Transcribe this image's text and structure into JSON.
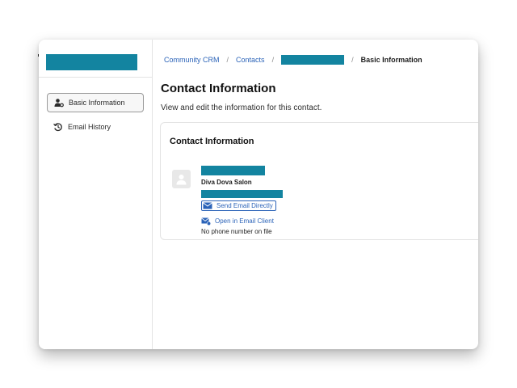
{
  "sidebar": {
    "items": [
      {
        "label": "Basic Information",
        "icon": "user-gear-icon",
        "active": true
      },
      {
        "label": "Email History",
        "icon": "history-icon",
        "active": false
      }
    ]
  },
  "breadcrumb": {
    "items": [
      "Community CRM",
      "Contacts"
    ],
    "current": "Basic Information"
  },
  "page": {
    "title": "Contact Information",
    "subtitle": "View and edit the information for this contact."
  },
  "card": {
    "title": "Contact Information",
    "company": "Diva Dova Salon",
    "send_email_label": "Send Email Directly",
    "open_client_label": "Open in Email Client",
    "phone_text": "No phone number on file"
  },
  "colors": {
    "redaction": "#1384a0",
    "link": "#2b63b8"
  }
}
